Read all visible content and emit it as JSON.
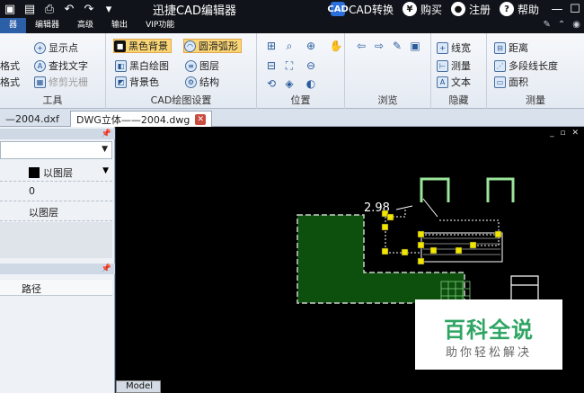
{
  "app": {
    "title": "迅捷CAD编辑器"
  },
  "title_actions": [
    {
      "icon": "cad-convert-icon",
      "label": "CAD转换"
    },
    {
      "icon": "cart-icon",
      "label": "购买"
    },
    {
      "icon": "user-icon",
      "label": "注册"
    },
    {
      "icon": "help-icon",
      "label": "帮助"
    }
  ],
  "menu": [
    "器",
    "编辑器",
    "高级",
    "输出",
    "VIP功能"
  ],
  "ribbon": {
    "tools": {
      "label": "工具",
      "items": [
        "格式",
        "格式",
        "显示点",
        "查找文字",
        "修剪光栅"
      ]
    },
    "draw_settings": {
      "label": "CAD绘图设置",
      "items": [
        "黑色背景",
        "黑白绘图",
        "背景色",
        "圆滑弧形",
        "图层",
        "结构"
      ]
    },
    "position": {
      "label": "位置"
    },
    "browse": {
      "label": "浏览"
    },
    "hide": {
      "label": "隐藏",
      "items": [
        "线宽",
        "测量",
        "文本"
      ]
    },
    "measure": {
      "label": "测量",
      "items": [
        "距离",
        "多段线长度",
        "面积"
      ]
    }
  },
  "tabs": [
    {
      "label": "—2004.dxf"
    },
    {
      "label": "DWG立体——2004.dwg"
    }
  ],
  "props": {
    "color": "以图层",
    "row2": "0",
    "row3": "以图层"
  },
  "list": {
    "column": "路径"
  },
  "canvas": {
    "dimension_text": "2.98",
    "model_tab": "Model",
    "dark_green": "#0d4f0d",
    "light_green": "#9be69b",
    "handle_yellow": "#f2e600"
  },
  "watermark": {
    "main": "百科全说",
    "sub": "助你轻松解决"
  }
}
